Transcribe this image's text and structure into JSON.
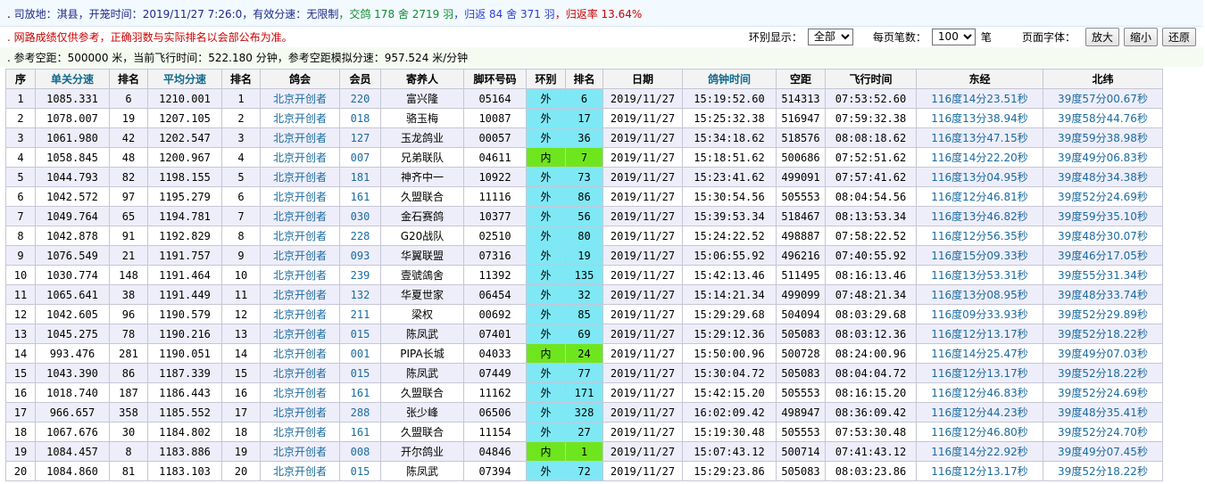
{
  "info": {
    "release_label": "司放地：",
    "release_value": "淇县",
    "start_label": "，开笼时间：",
    "start_value": "2019/11/27 7:26:0",
    "speed_label": "，有效分速：",
    "speed_value": "无限制",
    "handed_label": "，交鸽",
    "handed_count": "178",
    "handed_unit1": "舍",
    "handed_lofts": "2719",
    "handed_unit2": "羽",
    "returned_label": "，归返",
    "returned_lofts": "84",
    "returned_unit1": "舍",
    "returned_count": "371",
    "returned_unit2": "羽",
    "rate_label": "，归返率",
    "rate_value": "13.64%"
  },
  "notice": "网路成绩仅供参考，正确羽数与实际排名以会部公布为准。",
  "controls": {
    "ring_label": "环别显示：",
    "ring_value": "全部",
    "per_page_label": "每页笔数：",
    "per_page_value": "100",
    "per_page_unit": "笔",
    "font_label": "页面字体：",
    "enlarge": "放大",
    "shrink": "缩小",
    "restore": "还原"
  },
  "reference": {
    "text": "参考空距：500000 米，当前飞行时间：522.180 分钟，参考空距模拟分速：957.524 米/分钟"
  },
  "table": {
    "headers": [
      "序",
      "单关分速",
      "排名",
      "平均分速",
      "排名",
      "鸽会",
      "会员",
      "寄养人",
      "脚环号码",
      "环别",
      "排名",
      "日期",
      "鸽钟时间",
      "空距",
      "飞行时间",
      "东经",
      "北纬"
    ],
    "rows": [
      [
        "1",
        "1085.331",
        "6",
        "1210.001",
        "1",
        "北京开创者",
        "220",
        "富兴隆",
        "05164",
        "外",
        "6",
        "2019/11/27",
        "15:19:52.60",
        "514313",
        "07:53:52.60",
        "116度14分23.51秒",
        "39度57分00.67秒"
      ],
      [
        "2",
        "1078.007",
        "19",
        "1207.105",
        "2",
        "北京开创者",
        "018",
        "骆玉梅",
        "10087",
        "外",
        "17",
        "2019/11/27",
        "15:25:32.38",
        "516947",
        "07:59:32.38",
        "116度13分38.94秒",
        "39度58分44.76秒"
      ],
      [
        "3",
        "1061.980",
        "42",
        "1202.547",
        "3",
        "北京开创者",
        "127",
        "玉龙鸽业",
        "00057",
        "外",
        "36",
        "2019/11/27",
        "15:34:18.62",
        "518576",
        "08:08:18.62",
        "116度13分47.15秒",
        "39度59分38.98秒"
      ],
      [
        "4",
        "1058.845",
        "48",
        "1200.967",
        "4",
        "北京开创者",
        "007",
        "兄弟联队",
        "04611",
        "内",
        "7",
        "2019/11/27",
        "15:18:51.62",
        "500686",
        "07:52:51.62",
        "116度14分22.20秒",
        "39度49分06.83秒"
      ],
      [
        "5",
        "1044.793",
        "82",
        "1198.155",
        "5",
        "北京开创者",
        "181",
        "神齐中一",
        "10922",
        "外",
        "73",
        "2019/11/27",
        "15:23:41.62",
        "499091",
        "07:57:41.62",
        "116度13分04.95秒",
        "39度48分34.38秒"
      ],
      [
        "6",
        "1042.572",
        "97",
        "1195.279",
        "6",
        "北京开创者",
        "161",
        "久盟联合",
        "11116",
        "外",
        "86",
        "2019/11/27",
        "15:30:54.56",
        "505553",
        "08:04:54.56",
        "116度12分46.81秒",
        "39度52分24.69秒"
      ],
      [
        "7",
        "1049.764",
        "65",
        "1194.781",
        "7",
        "北京开创者",
        "030",
        "金石赛鸽",
        "10377",
        "外",
        "56",
        "2019/11/27",
        "15:39:53.34",
        "518467",
        "08:13:53.34",
        "116度13分46.82秒",
        "39度59分35.10秒"
      ],
      [
        "8",
        "1042.878",
        "91",
        "1192.829",
        "8",
        "北京开创者",
        "228",
        "G20战队",
        "02510",
        "外",
        "80",
        "2019/11/27",
        "15:24:22.52",
        "498887",
        "07:58:22.52",
        "116度12分56.35秒",
        "39度48分30.07秒"
      ],
      [
        "9",
        "1076.549",
        "21",
        "1191.757",
        "9",
        "北京开创者",
        "093",
        "华翼联盟",
        "07316",
        "外",
        "19",
        "2019/11/27",
        "15:06:55.92",
        "496216",
        "07:40:55.92",
        "116度15分09.33秒",
        "39度46分17.05秒"
      ],
      [
        "10",
        "1030.774",
        "148",
        "1191.464",
        "10",
        "北京开创者",
        "239",
        "壹號鴿舍",
        "11392",
        "外",
        "135",
        "2019/11/27",
        "15:42:13.46",
        "511495",
        "08:16:13.46",
        "116度13分53.31秒",
        "39度55分31.34秒"
      ],
      [
        "11",
        "1065.641",
        "38",
        "1191.449",
        "11",
        "北京开创者",
        "132",
        "华夏世家",
        "06454",
        "外",
        "32",
        "2019/11/27",
        "15:14:21.34",
        "499099",
        "07:48:21.34",
        "116度13分08.95秒",
        "39度48分33.74秒"
      ],
      [
        "12",
        "1042.605",
        "96",
        "1190.579",
        "12",
        "北京开创者",
        "211",
        "梁权",
        "00692",
        "外",
        "85",
        "2019/11/27",
        "15:29:29.68",
        "504094",
        "08:03:29.68",
        "116度09分33.93秒",
        "39度52分29.89秒"
      ],
      [
        "13",
        "1045.275",
        "78",
        "1190.216",
        "13",
        "北京开创者",
        "015",
        "陈凤武",
        "07401",
        "外",
        "69",
        "2019/11/27",
        "15:29:12.36",
        "505083",
        "08:03:12.36",
        "116度12分13.17秒",
        "39度52分18.22秒"
      ],
      [
        "14",
        "993.476",
        "281",
        "1190.051",
        "14",
        "北京开创者",
        "001",
        "PIPA长城",
        "04033",
        "内",
        "24",
        "2019/11/27",
        "15:50:00.96",
        "500728",
        "08:24:00.96",
        "116度14分25.47秒",
        "39度49分07.03秒"
      ],
      [
        "15",
        "1043.390",
        "86",
        "1187.339",
        "15",
        "北京开创者",
        "015",
        "陈凤武",
        "07449",
        "外",
        "77",
        "2019/11/27",
        "15:30:04.72",
        "505083",
        "08:04:04.72",
        "116度12分13.17秒",
        "39度52分18.22秒"
      ],
      [
        "16",
        "1018.740",
        "187",
        "1186.443",
        "16",
        "北京开创者",
        "161",
        "久盟联合",
        "11162",
        "外",
        "171",
        "2019/11/27",
        "15:42:15.20",
        "505553",
        "08:16:15.20",
        "116度12分46.83秒",
        "39度52分24.69秒"
      ],
      [
        "17",
        "966.657",
        "358",
        "1185.552",
        "17",
        "北京开创者",
        "288",
        "张少峰",
        "06506",
        "外",
        "328",
        "2019/11/27",
        "16:02:09.42",
        "498947",
        "08:36:09.42",
        "116度12分44.23秒",
        "39度48分35.41秒"
      ],
      [
        "18",
        "1067.676",
        "30",
        "1184.802",
        "18",
        "北京开创者",
        "161",
        "久盟联合",
        "11154",
        "外",
        "27",
        "2019/11/27",
        "15:19:30.48",
        "505553",
        "07:53:30.48",
        "116度12分46.80秒",
        "39度52分24.70秒"
      ],
      [
        "19",
        "1084.457",
        "8",
        "1183.886",
        "19",
        "北京开创者",
        "008",
        "开尔鸽业",
        "04846",
        "内",
        "1",
        "2019/11/27",
        "15:07:43.12",
        "500714",
        "07:41:43.12",
        "116度14分22.92秒",
        "39度49分07.45秒"
      ],
      [
        "20",
        "1084.860",
        "81",
        "1183.103",
        "20",
        "北京开创者",
        "015",
        "陈凤武",
        "07394",
        "外",
        "72",
        "2019/11/27",
        "15:29:23.86",
        "505083",
        "08:03:23.86",
        "116度12分13.17秒",
        "39度52分18.22秒"
      ]
    ]
  }
}
